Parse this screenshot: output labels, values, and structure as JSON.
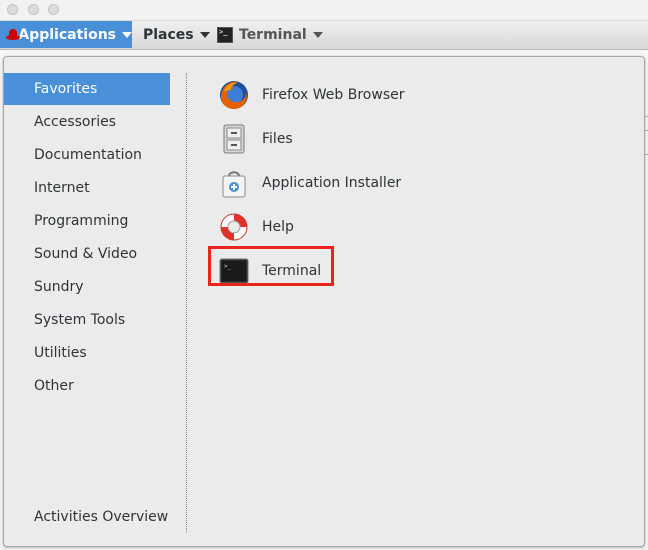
{
  "panel": {
    "applications_label": "Applications",
    "places_label": "Places",
    "terminal_label": "Terminal"
  },
  "menu": {
    "categories": [
      {
        "label": "Favorites",
        "selected": true
      },
      {
        "label": "Accessories"
      },
      {
        "label": "Documentation"
      },
      {
        "label": "Internet"
      },
      {
        "label": "Programming"
      },
      {
        "label": "Sound & Video"
      },
      {
        "label": "Sundry"
      },
      {
        "label": "System Tools"
      },
      {
        "label": "Utilities"
      },
      {
        "label": "Other"
      }
    ],
    "apps": [
      {
        "label": "Firefox Web Browser",
        "icon": "firefox-icon"
      },
      {
        "label": "Files",
        "icon": "files-cabinet-icon"
      },
      {
        "label": "Application Installer",
        "icon": "software-bag-icon"
      },
      {
        "label": "Help",
        "icon": "lifebuoy-icon"
      },
      {
        "label": "Terminal",
        "icon": "terminal-icon",
        "highlighted": true
      }
    ],
    "activities_overview": "Activities Overview"
  },
  "colors": {
    "accent": "#4a90d9",
    "highlight_box": "#e8251b"
  }
}
